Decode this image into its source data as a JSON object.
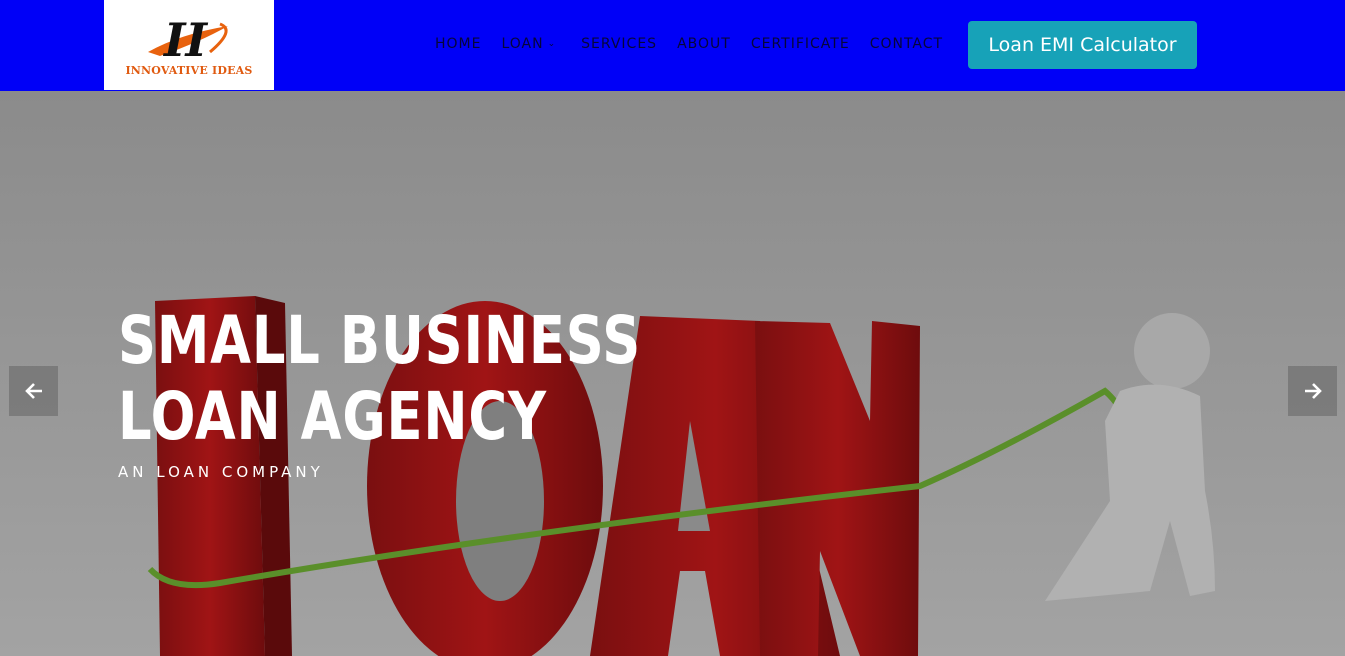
{
  "logo": {
    "mark": "II",
    "text": "INNOVATIVE IDEAS",
    "mark_color": "#111111",
    "swoosh_color": "#e8620e"
  },
  "nav": {
    "items": [
      {
        "label": "HOME"
      },
      {
        "label": "LOAN",
        "has_dropdown": true,
        "icon": "chevron-down-icon"
      },
      {
        "label": "SERVICES"
      },
      {
        "label": "ABOUT"
      },
      {
        "label": "CERTIFICATE"
      },
      {
        "label": "CONTACT"
      }
    ],
    "cta_label": "Loan EMI Calculator",
    "cta_color": "#17a2b8",
    "background": "#0000f7"
  },
  "hero": {
    "title_line1": "SMALL BUSINESS",
    "title_line2": "LOAN AGENCY",
    "subtitle": "AN LOAN COMPANY",
    "prev_icon": "arrow-left-icon",
    "next_icon": "arrow-right-icon"
  }
}
